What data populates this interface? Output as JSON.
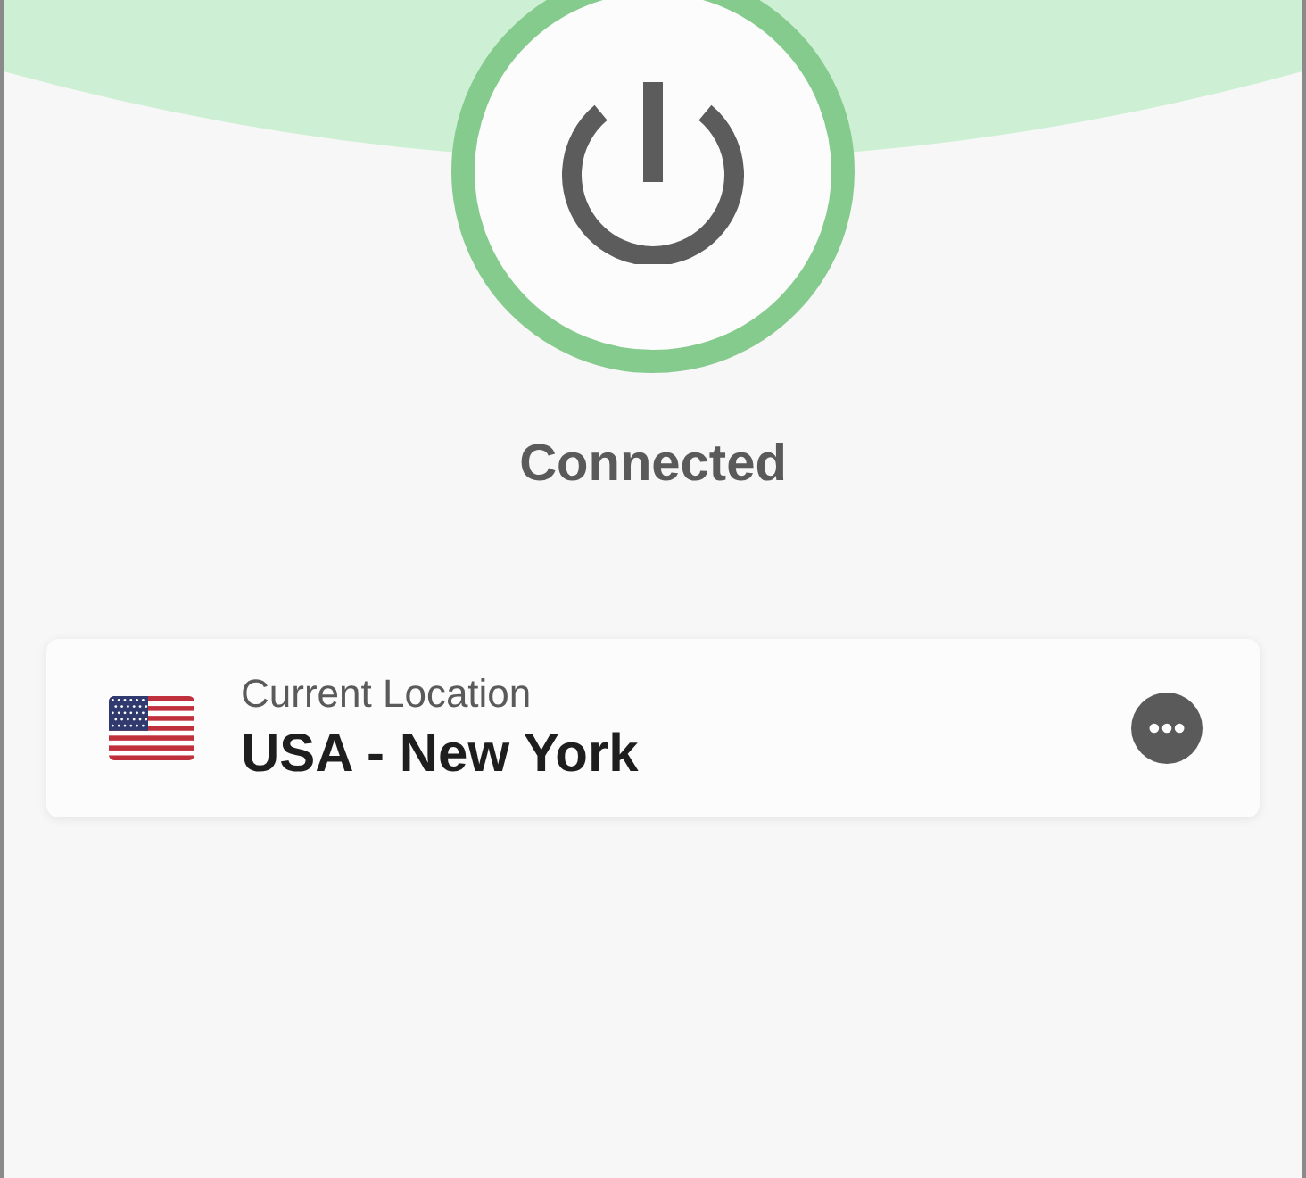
{
  "status": {
    "label": "Connected",
    "connected": true
  },
  "location": {
    "caption": "Current Location",
    "name": "USA - New York"
  }
}
